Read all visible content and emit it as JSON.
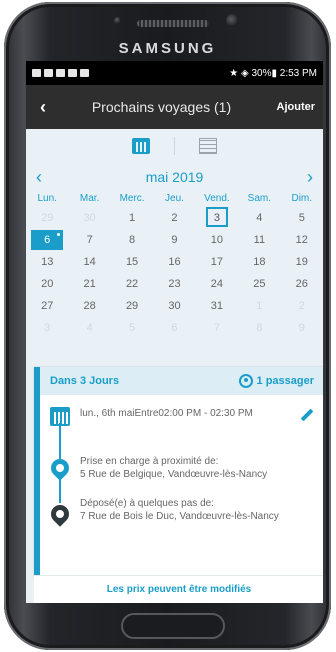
{
  "device": {
    "brand": "SAMSUNG"
  },
  "status_bar": {
    "right": "★ ◈ 30%▮ 2:53 PM"
  },
  "app_bar": {
    "back": "‹",
    "title": "Prochains voyages (1)",
    "action": "Ajouter"
  },
  "view_toggle": {
    "icons": [
      "calendar-icon",
      "list-icon"
    ],
    "active": "calendar"
  },
  "calendar": {
    "month": "mai 2019",
    "prev": "‹",
    "next": "›",
    "weekdays": [
      "Lun.",
      "Mar.",
      "Merc.",
      "Jeu.",
      "Vend.",
      "Sam.",
      "Dim."
    ],
    "weeks": [
      [
        "29",
        "30",
        "1",
        "2",
        "3",
        "4",
        "5"
      ],
      [
        "6",
        "7",
        "8",
        "9",
        "10",
        "11",
        "12"
      ],
      [
        "13",
        "14",
        "15",
        "16",
        "17",
        "18",
        "19"
      ],
      [
        "20",
        "21",
        "22",
        "23",
        "24",
        "25",
        "26"
      ],
      [
        "27",
        "28",
        "29",
        "30",
        "31",
        "1",
        "2"
      ],
      [
        "3",
        "4",
        "5",
        "6",
        "7",
        "8",
        "9"
      ]
    ],
    "selected_day": "6",
    "today": "3"
  },
  "trip": {
    "when": "Dans 3 Jours",
    "passengers": "1 passager",
    "datetime": "lun., 6th maiEntre02:00 PM - 02:30 PM",
    "pickup_label": "Prise en charge à proximité de:",
    "pickup_address": "5 Rue de Belgique, Vandœuvre-lès-Nancy",
    "dropoff_label": "Déposé(e) à quelques pas de:",
    "dropoff_address": "7 Rue de Bois le Duc, Vandœuvre-lès-Nancy"
  },
  "footer": {
    "text": "Les prix peuvent être modifiés"
  },
  "colors": {
    "accent": "#1a9ec9",
    "app_bar": "#2e2e2e",
    "background": "#e9f1f6"
  }
}
